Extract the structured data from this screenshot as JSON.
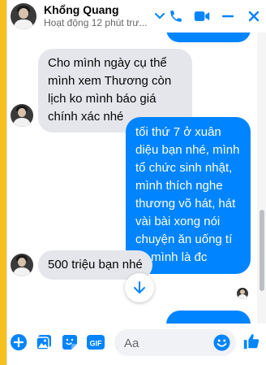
{
  "header": {
    "name": "Khổng Quang",
    "status": "Hoạt động 12 phút trư..."
  },
  "messages": [
    {
      "from": "contact",
      "text": "Cho mình ngày cụ thể mình xem Thương còn lịch ko mình báo giá chính xác nhé"
    },
    {
      "from": "me",
      "text": "tối thứ 7 ở xuân diệu bạn nhé, mình tổ chức sinh nhật, mình thích nghe thương võ hát, hát vài bài xong nói chuyện ăn uống tí vs mình là đc"
    },
    {
      "from": "contact",
      "text": "500 triệu bạn nhé"
    }
  ],
  "composer": {
    "placeholder": "Aa"
  },
  "colors": {
    "accent": "#0084ff",
    "incoming_bubble": "#e4e6eb",
    "status_text": "#65676b"
  },
  "icons": {
    "header": [
      "chevron-down-icon",
      "phone-icon",
      "video-camera-icon",
      "minimize-icon",
      "close-icon"
    ],
    "composer": [
      "plus-icon",
      "image-icon",
      "sticker-icon",
      "gif-icon",
      "emoji-icon",
      "thumbs-up-icon"
    ],
    "overlay": [
      "arrow-down-icon"
    ]
  }
}
